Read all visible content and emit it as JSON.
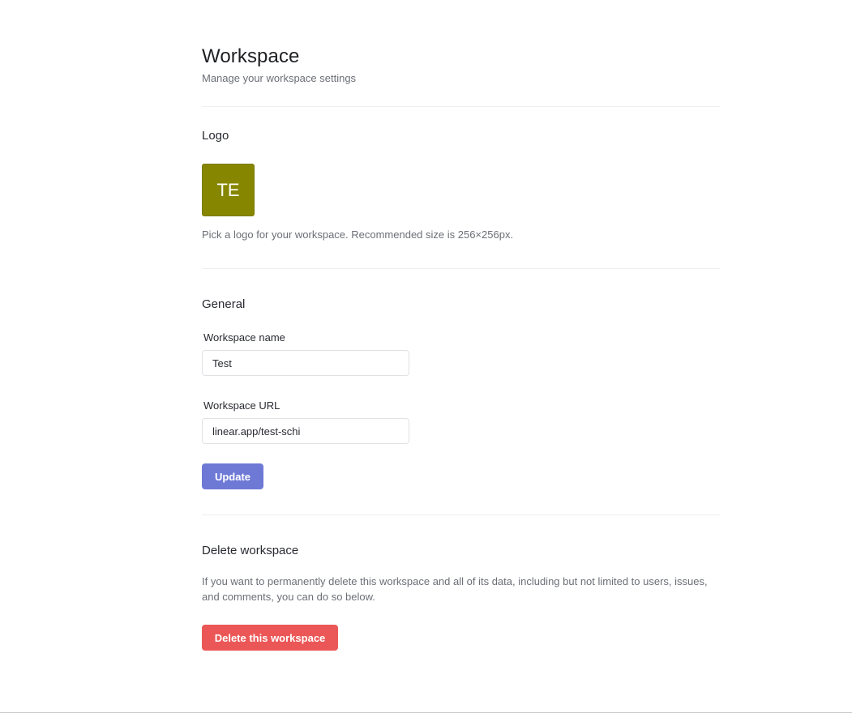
{
  "header": {
    "title": "Workspace",
    "subtitle": "Manage your workspace settings"
  },
  "logo_section": {
    "heading": "Logo",
    "logo_initials": "TE",
    "logo_color": "#868600",
    "help_text": "Pick a logo for your workspace. Recommended size is 256×256px."
  },
  "general_section": {
    "heading": "General",
    "workspace_name": {
      "label": "Workspace name",
      "value": "Test"
    },
    "workspace_url": {
      "label": "Workspace URL",
      "value": "linear.app/test-schi"
    },
    "update_label": "Update",
    "update_color": "#6e79d6"
  },
  "delete_section": {
    "heading": "Delete workspace",
    "description": "If you want to permanently delete this workspace and all of its data, including but not limited to users, issues, and comments, you can do so below.",
    "delete_label": "Delete this workspace",
    "delete_color": "#eb5757"
  }
}
